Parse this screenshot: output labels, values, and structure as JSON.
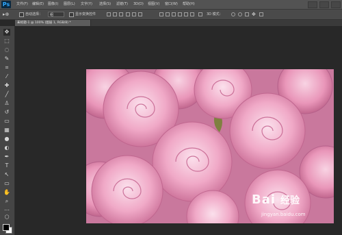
{
  "app": {
    "logo": "Ps"
  },
  "menu": [
    "文件(F)",
    "编辑(E)",
    "图像(I)",
    "图层(L)",
    "文字(Y)",
    "选择(S)",
    "滤镜(T)",
    "3D(D)",
    "视图(V)",
    "窗口(W)",
    "帮助(H)"
  ],
  "options": {
    "auto_select_label": "自动选择：",
    "auto_select_value": "组",
    "show_transform_label": "显示变换控件",
    "mode_3d_label": "3D 模式："
  },
  "document": {
    "tab_title": "未标题-1 @ 100% (图层 1, RGB/8) *",
    "close": "×"
  },
  "watermark": {
    "logo": "Bai",
    "logo2": "经验",
    "url": "jingyan.baidu.com"
  },
  "colors": {
    "menubar": "#535353",
    "canvas_bg": "#282828",
    "accent": "#31a8ff",
    "foreground": "#000000",
    "background": "#ffffff"
  },
  "icons": [
    "move-icon",
    "marquee-icon",
    "lasso-icon",
    "quick-select-icon",
    "crop-icon",
    "eyedropper-icon",
    "healing-icon",
    "brush-icon",
    "stamp-icon",
    "history-brush-icon",
    "eraser-icon",
    "gradient-icon",
    "blur-icon",
    "dodge-icon",
    "pen-icon",
    "type-icon",
    "path-select-icon",
    "shape-icon",
    "hand-icon",
    "zoom-icon"
  ]
}
